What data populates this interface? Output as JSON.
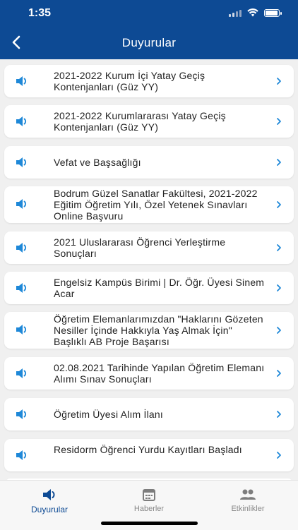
{
  "status": {
    "time": "1:35"
  },
  "header": {
    "title": "Duyurular",
    "back_icon": "chevron-left-icon"
  },
  "colors": {
    "primary": "#0d4a94",
    "accent": "#1e88d8",
    "inactive": "#888888"
  },
  "announcements": [
    {
      "title": "2021-2022 Kurum İçi Yatay Geçiş Kontenjanları (Güz YY)"
    },
    {
      "title": "2021-2022 Kurumlararası Yatay Geçiş Kontenjanları (Güz YY)"
    },
    {
      "title": "Vefat ve Başsağlığı"
    },
    {
      "title": "Bodrum Güzel Sanatlar Fakültesi, 2021-2022 Eğitim Öğretim Yılı, Özel Yetenek Sınavları Online Başvuru"
    },
    {
      "title": "2021 Uluslararası Öğrenci Yerleştirme Sonuçları"
    },
    {
      "title": "Engelsiz Kampüs Birimi | Dr. Öğr. Üyesi Sinem Acar"
    },
    {
      "title": "Öğretim Elemanlarımızdan \"Haklarını Gözeten Nesiller İçinde Hakkıyla Yaş Almak İçin\" Başlıklı AB Proje Başarısı"
    },
    {
      "title": "02.08.2021 Tarihinde Yapılan Öğretim Elemanı Alımı Sınav Sonuçları"
    },
    {
      "title": "Öğretim Üyesi Alım İlanı"
    },
    {
      "title": "Residorm Öğrenci Yurdu Kayıtları Başladı"
    }
  ],
  "tabs": [
    {
      "label": "Duyurular",
      "icon": "megaphone-icon",
      "active": true
    },
    {
      "label": "Haberler",
      "icon": "calendar-icon",
      "active": false
    },
    {
      "label": "Etkinlikler",
      "icon": "people-icon",
      "active": false
    }
  ]
}
